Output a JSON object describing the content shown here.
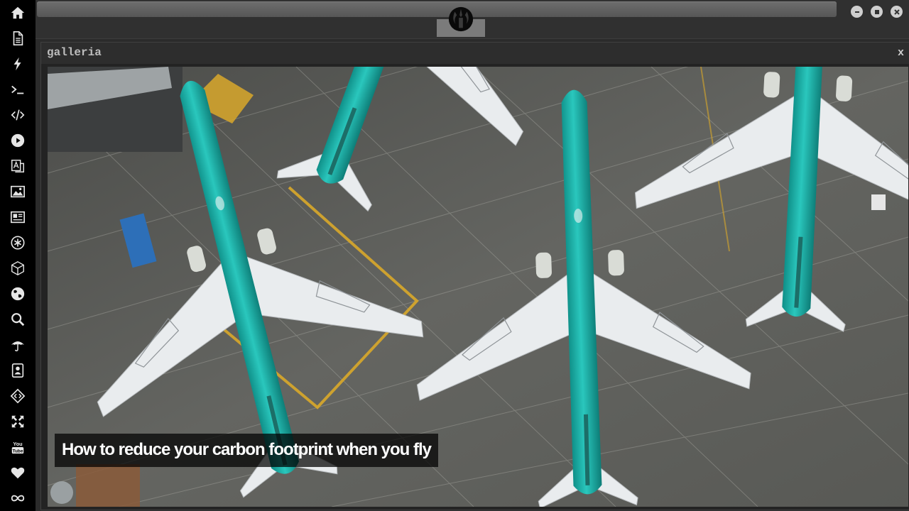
{
  "window": {
    "url_value": "",
    "buttons": [
      {
        "name": "minimize",
        "icon": "minus-icon"
      },
      {
        "name": "maximize",
        "icon": "square-icon"
      },
      {
        "name": "close",
        "icon": "x-icon"
      }
    ]
  },
  "sidebar": {
    "items": [
      {
        "name": "home",
        "icon": "home-icon"
      },
      {
        "name": "document",
        "icon": "document-icon"
      },
      {
        "name": "lightning",
        "icon": "lightning-icon"
      },
      {
        "name": "terminal",
        "icon": "terminal-icon"
      },
      {
        "name": "code",
        "icon": "code-icon"
      },
      {
        "name": "play",
        "icon": "play-icon"
      },
      {
        "name": "translate",
        "icon": "translate-icon"
      },
      {
        "name": "image",
        "icon": "image-icon"
      },
      {
        "name": "news",
        "icon": "newspaper-icon"
      },
      {
        "name": "asterisk",
        "icon": "asterisk-icon"
      },
      {
        "name": "cube",
        "icon": "cube-icon"
      },
      {
        "name": "globe",
        "icon": "globe-icon"
      },
      {
        "name": "search",
        "icon": "search-icon"
      },
      {
        "name": "umbrella",
        "icon": "umbrella-icon"
      },
      {
        "name": "contact",
        "icon": "contact-card-icon"
      },
      {
        "name": "diamond-code",
        "icon": "diamond-code-icon"
      },
      {
        "name": "expand",
        "icon": "expand-icon"
      },
      {
        "name": "youtube",
        "icon": "youtube-icon"
      },
      {
        "name": "heart",
        "icon": "heart-icon"
      },
      {
        "name": "infinity",
        "icon": "infinity-icon"
      }
    ]
  },
  "logo": {
    "icon": "rebel-alliance-icon"
  },
  "panel": {
    "title": "galleria",
    "close_label": "x",
    "caption": "How to reduce your carbon footprint when you fly"
  },
  "colors": {
    "sidebar": "#000000",
    "background": "#2b2b2b",
    "fuselage": "#17a7a0",
    "tarmac": "#5e5f5c",
    "taxi_line": "#d9a82a"
  }
}
